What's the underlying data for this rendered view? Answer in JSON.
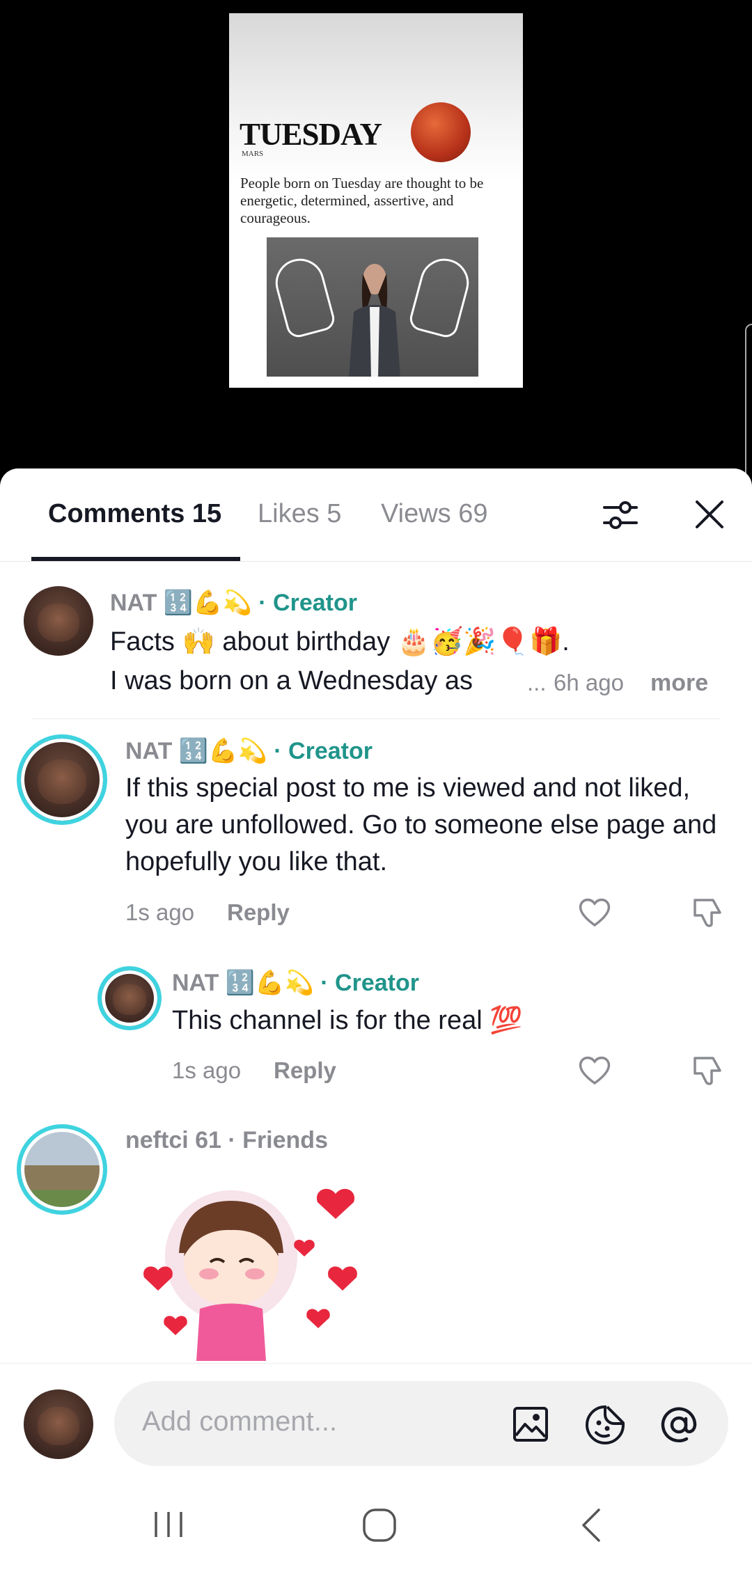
{
  "post": {
    "title": "TUESDAY",
    "subtitle": "MARS",
    "text": "People born on Tuesday are thought to be energetic, determined, assertive, and courageous."
  },
  "tabs": {
    "comments": "Comments 15",
    "likes": "Likes 5",
    "views": "Views 69"
  },
  "comments": [
    {
      "name": "NAT 🔢💪💫",
      "role": "· Creator",
      "text1": "Facts 🙌 about birthday 🎂🥳🎉🎈🎁.",
      "text2": "I was born on a Wednesday as",
      "ellipsis": "...",
      "time": "6h ago",
      "more": "more"
    },
    {
      "name": "NAT 🔢💪💫",
      "role": "· Creator",
      "text": "If this special post to me is viewed and not liked, you are unfollowed. Go to someone else page and hopefully you like that.",
      "time": "1s ago",
      "reply": "Reply"
    },
    {
      "name": "NAT 🔢💪💫",
      "role": "· Creator",
      "text": "This channel is for the real 💯",
      "time": "1s ago",
      "reply": "Reply"
    },
    {
      "name": "neftci 61",
      "role": "· Friends"
    }
  ],
  "composer": {
    "placeholder": "Add comment..."
  },
  "colors": {
    "creator": "#20948a",
    "ring": "#3fd3e0"
  },
  "icons": [
    "filter-icon",
    "close-icon",
    "heart-icon",
    "dislike-icon",
    "image-icon",
    "emoji-icon",
    "mention-icon",
    "recents-icon",
    "home-icon",
    "back-icon"
  ]
}
